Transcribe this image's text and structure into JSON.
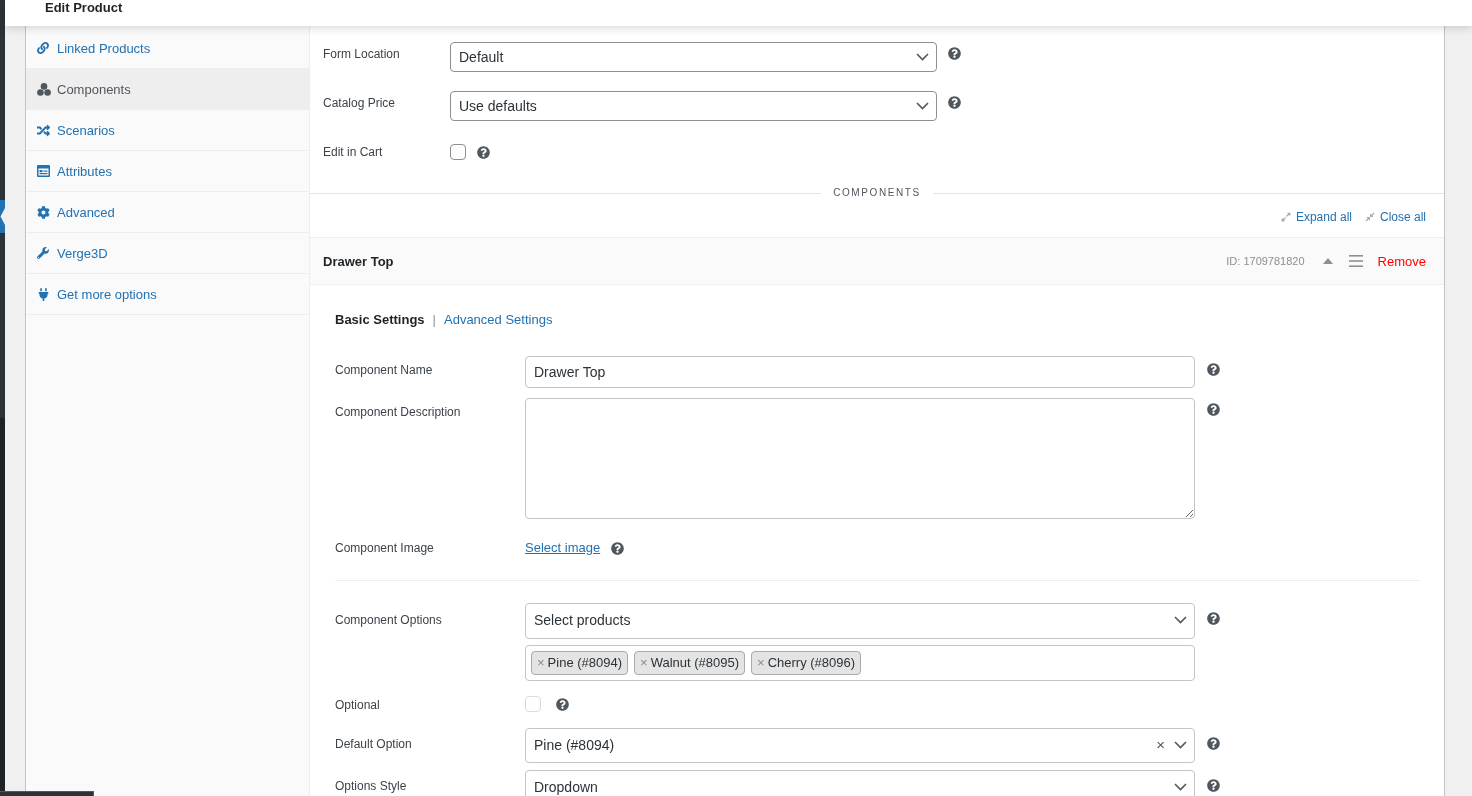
{
  "header": {
    "title": "Edit Product"
  },
  "sidebar": {
    "items": [
      {
        "label": "Linked Products",
        "selected": false
      },
      {
        "label": "Components",
        "selected": true
      },
      {
        "label": "Scenarios",
        "selected": false
      },
      {
        "label": "Attributes",
        "selected": false
      },
      {
        "label": "Advanced",
        "selected": false
      },
      {
        "label": "Verge3D",
        "selected": false
      },
      {
        "label": "Get more options",
        "selected": false
      }
    ]
  },
  "settings": [
    {
      "kind": "select",
      "label": "Form Location",
      "value": "Default"
    },
    {
      "kind": "select",
      "label": "Catalog Price",
      "value": "Use defaults"
    },
    {
      "kind": "checkbox",
      "label": "Edit in Cart",
      "checked": false
    }
  ],
  "section_title": "COMPONENTS",
  "toolbar": {
    "expand_all": "Expand all",
    "close_all": "Close all"
  },
  "component": {
    "title": "Drawer Top",
    "id": "ID: 1709781820",
    "expanded": true,
    "remove": "Remove",
    "tabs": [
      {
        "label": "Basic Settings",
        "selected": true
      },
      {
        "label": "Advanced Settings",
        "selected": false
      }
    ],
    "tab_separator": "|",
    "fields": [
      {
        "kind": "text",
        "label": "Component Name",
        "value": "Drawer Top"
      },
      {
        "kind": "textarea",
        "label": "Component Description"
      },
      {
        "kind": "link",
        "label": "Component Image",
        "link": "Select image"
      }
    ],
    "option_fields": [
      {
        "kind": "multiselect",
        "label": "Component Options",
        "placeholder": "Select products",
        "tags": [
          {
            "remove": "×",
            "label": "Pine (#8094)"
          },
          {
            "remove": "×",
            "label": "Walnut (#8095)"
          },
          {
            "remove": "×",
            "label": "Cherry (#8096)"
          }
        ]
      },
      {
        "kind": "checkbox",
        "label": "Optional",
        "checked": false
      },
      {
        "kind": "select",
        "label": "Default Option",
        "value": "Pine (#8094)",
        "clear": "×"
      },
      {
        "kind": "select",
        "label": "Options Style",
        "value": "Dropdown"
      }
    ]
  }
}
